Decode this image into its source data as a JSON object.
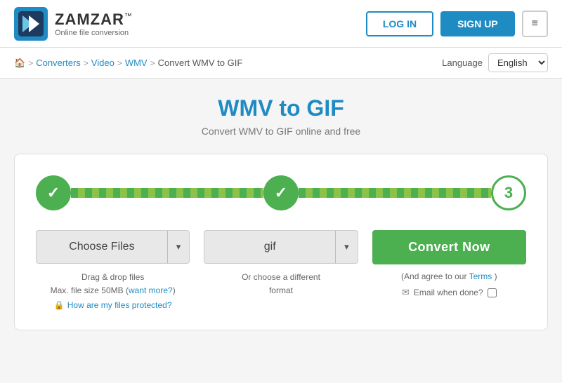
{
  "header": {
    "logo_brand": "ZAMZAR",
    "logo_tm": "™",
    "logo_sub": "Online file conversion",
    "btn_login": "LOG IN",
    "btn_signup": "SIGN UP",
    "menu_icon": "≡"
  },
  "breadcrumb": {
    "home_icon": "🏠",
    "items": [
      {
        "label": "Converters",
        "link": true
      },
      {
        "label": "Video",
        "link": true
      },
      {
        "label": "WMV",
        "link": true
      },
      {
        "label": "Convert WMV to GIF",
        "link": false
      }
    ],
    "language_label": "Language",
    "language_value": "English"
  },
  "page": {
    "title": "WMV to GIF",
    "subtitle": "Convert WMV to GIF online and free"
  },
  "steps": [
    {
      "id": 1,
      "state": "done",
      "symbol": "✓"
    },
    {
      "id": 2,
      "state": "done",
      "symbol": "✓"
    },
    {
      "id": 3,
      "state": "active",
      "symbol": "3"
    }
  ],
  "col_choose": {
    "btn_label": "Choose Files",
    "dropdown_arrow": "▾",
    "info_drag": "Drag & drop files",
    "info_size": "Max. file size 50MB",
    "info_want_more": "want more?",
    "protection_label": "How are my files protected?",
    "lock_icon": "🔒"
  },
  "col_format": {
    "format_value": "gif",
    "dropdown_arrow": "▾",
    "info_line1": "Or choose a different",
    "info_line2": "format"
  },
  "col_convert": {
    "btn_label": "Convert Now",
    "terms_prefix": "(And agree to our",
    "terms_link": "Terms",
    "terms_suffix": ")",
    "email_label": "Email when done?",
    "email_icon": "✉"
  }
}
